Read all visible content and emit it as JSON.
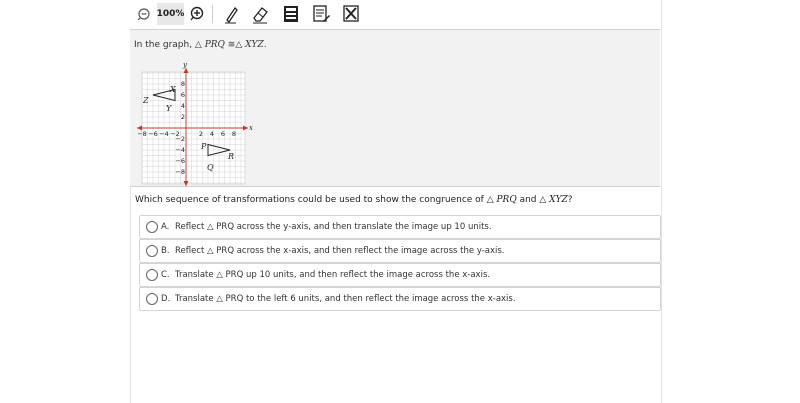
{
  "toolbar": {
    "zoom": "100%",
    "icons": [
      "zoom-out-icon",
      "zoom-in-icon",
      "pen-icon",
      "eraser-icon",
      "calculator-icon",
      "notepad-icon",
      "eliminate-icon"
    ]
  },
  "stem": {
    "prefix": "In the graph, △ ",
    "tri1": "PRQ",
    "cong": " ≅△ ",
    "tri2": "XYZ",
    "suffix": "."
  },
  "graph": {
    "x_label": "x",
    "y_label": "y",
    "x_ticks": [
      "−8",
      "−6",
      "−4",
      "−2",
      "2",
      "4",
      "6",
      "8"
    ],
    "y_ticks": [
      "8",
      "6",
      "4",
      "2",
      "−2",
      "−4",
      "−6",
      "−8"
    ],
    "points": {
      "X": "X",
      "Y": "Y",
      "Z": "Z",
      "P": "P",
      "R": "R",
      "Q": "Q"
    }
  },
  "question": {
    "prefix": "Which sequence of transformations could be used to show the congruence of △ ",
    "tri1": "PRQ",
    "mid": " and △ ",
    "tri2": "XYZ",
    "suffix": "?"
  },
  "choices": [
    {
      "letter": "A.",
      "text": "Reflect △ PRQ across the y-axis, and then translate the image up 10 units."
    },
    {
      "letter": "B.",
      "text": "Reflect △ PRQ across the x-axis, and then reflect the image across the y-axis."
    },
    {
      "letter": "C.",
      "text": "Translate △ PRQ up 10 units, and then reflect the image across the x-axis."
    },
    {
      "letter": "D.",
      "text": "Translate △ PRQ to the left 6 units, and then reflect the image across the x-axis."
    }
  ],
  "colors": {
    "axis": "#c0392b",
    "grid": "#c8c8c8",
    "accent": "#1a5fa8"
  }
}
